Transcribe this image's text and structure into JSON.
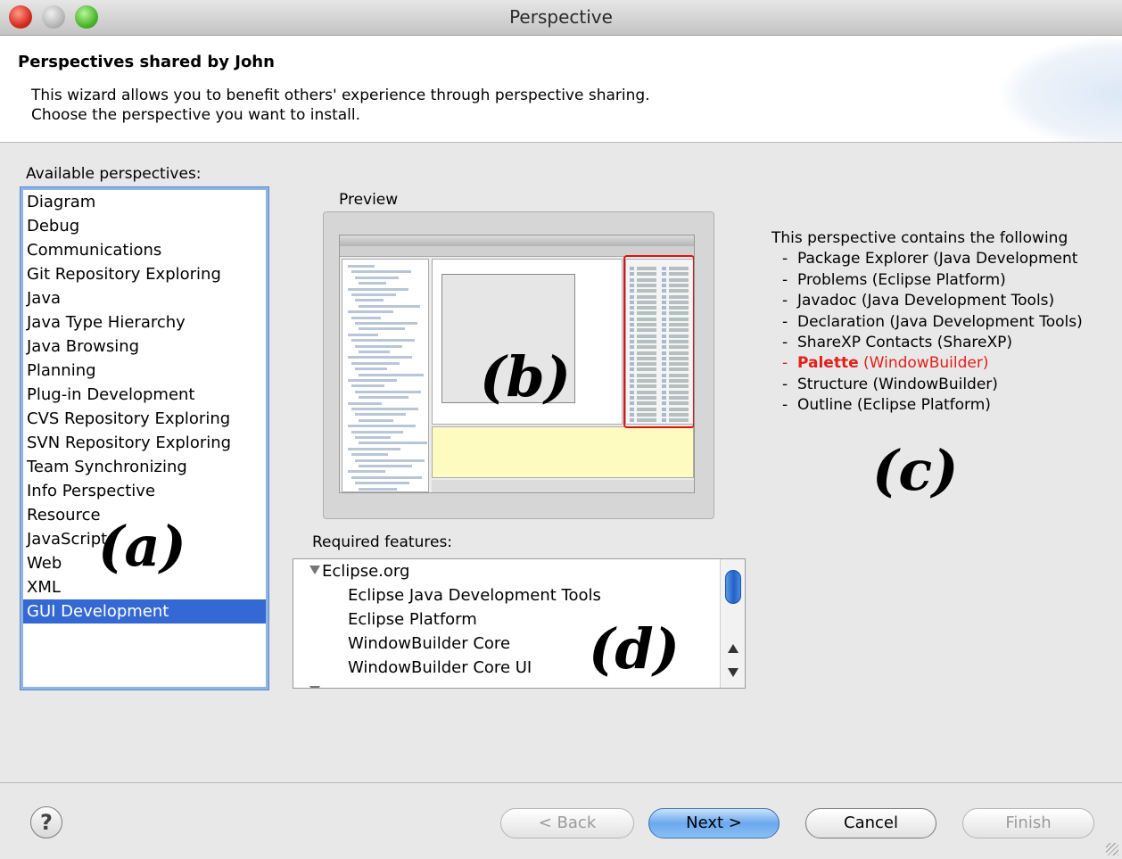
{
  "window": {
    "title": "Perspective"
  },
  "header": {
    "title": "Perspectives shared by John",
    "description_line1": "This wizard allows you to benefit others' experience through perspective sharing.",
    "description_line2": "Choose the perspective you want to install."
  },
  "perspectives": {
    "label": "Available perspectives:",
    "items": [
      "Diagram",
      "Debug",
      "Communications",
      "Git Repository Exploring",
      "Java",
      "Java Type Hierarchy",
      "Java Browsing",
      "Planning",
      "Plug-in Development",
      "CVS Repository Exploring",
      "SVN Repository Exploring",
      "Team Synchronizing",
      "Info Perspective",
      "Resource",
      "JavaScript",
      "Web",
      "XML",
      "GUI Development"
    ],
    "selected": "GUI Development"
  },
  "preview": {
    "label": "Preview"
  },
  "contents": {
    "intro": "This perspective contains the following",
    "items": [
      {
        "name": "Package Explorer",
        "source": "(Java Development"
      },
      {
        "name": "Problems",
        "source": "(Eclipse Platform)"
      },
      {
        "name": "Javadoc",
        "source": "(Java Development Tools)"
      },
      {
        "name": "Declaration",
        "source": "(Java Development Tools)"
      },
      {
        "name": "ShareXP Contacts",
        "source": "(ShareXP)"
      },
      {
        "name": "Palette",
        "source": "(WindowBuilder)",
        "highlight": true
      },
      {
        "name": "Structure",
        "source": "(WindowBuilder)"
      },
      {
        "name": "Outline",
        "source": "(Eclipse Platform)"
      }
    ],
    "highlight_color": "#e0201a"
  },
  "features": {
    "label": "Required features:",
    "group": "Eclipse.org",
    "items": [
      "Eclipse Java Development Tools",
      "Eclipse Platform",
      "WindowBuilder Core",
      "WindowBuilder Core UI"
    ]
  },
  "annotations": {
    "a": "(a)",
    "b": "(b)",
    "c": "(c)",
    "d": "(d)"
  },
  "buttons": {
    "help": "?",
    "back": "< Back",
    "next": "Next >",
    "cancel": "Cancel",
    "finish": "Finish"
  },
  "colors": {
    "selection": "#3468d2",
    "accent_button": "#6aa8ee"
  }
}
